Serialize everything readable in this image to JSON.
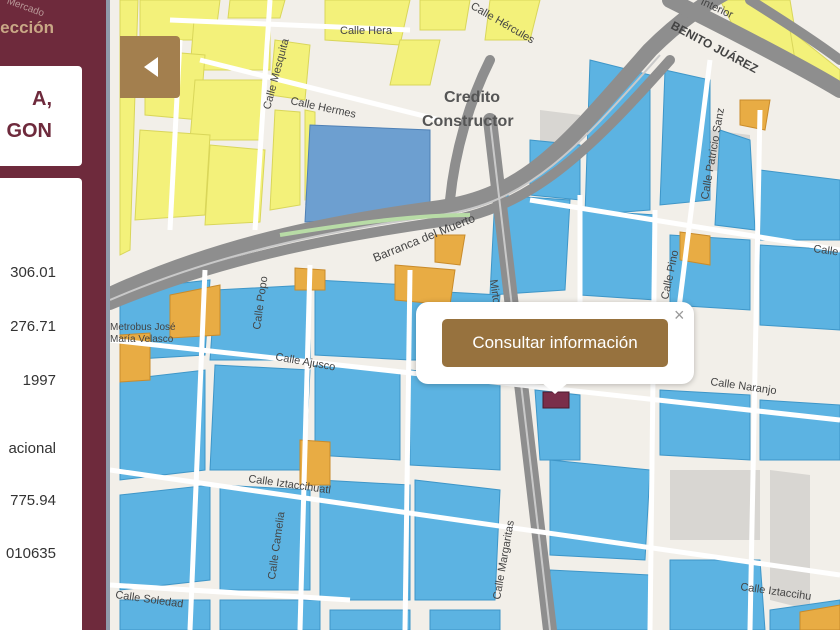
{
  "panel": {
    "title_fragment": "elección",
    "mercado_fragment": "Mercado",
    "address_lines": [
      "A,",
      "GON"
    ],
    "details": [
      "306.01",
      "276.71",
      "1997",
      "acional",
      "775.94",
      "010635"
    ]
  },
  "popup": {
    "button_label": "Consultar información",
    "close_glyph": "×"
  },
  "map": {
    "areas": [
      "Credito",
      "Constructor"
    ],
    "streets": {
      "hera": "Calle Hera",
      "hercules": "Calle Hércules",
      "benito": "BENITO JUÁREZ",
      "benito_prefix": "Interior",
      "mesquita": "Calle Mesquita",
      "hermes": "Calle Hermes",
      "patricio": "Calle Patricio Sanz",
      "barranca": "Barranca del Muerto",
      "popo": "Calle Popo",
      "pino": "Calle Pino",
      "mirto": "Mirto",
      "ajusco": "Calle Ajusco",
      "naranjo": "Calle Naranjo",
      "iztaccihuatl": "Calle Iztaccihuatl",
      "iztaccihuatl_right": "Calle Iztaccihu",
      "camelia": "Calle Camelia",
      "margaritas": "Calle Margaritas",
      "soledad": "Calle Soledad",
      "cali": "Calle"
    },
    "poi": [
      "Metrobus José",
      "María Velasco"
    ],
    "colors": {
      "residential": "#5cb3e2",
      "mixed": "#f3f17a",
      "commercial": "#e8ac44",
      "selected": "#7a2e4a",
      "roads": "#8e8e8e"
    }
  },
  "icons": {
    "collapse": "chevron-left-icon",
    "close": "close-icon"
  }
}
